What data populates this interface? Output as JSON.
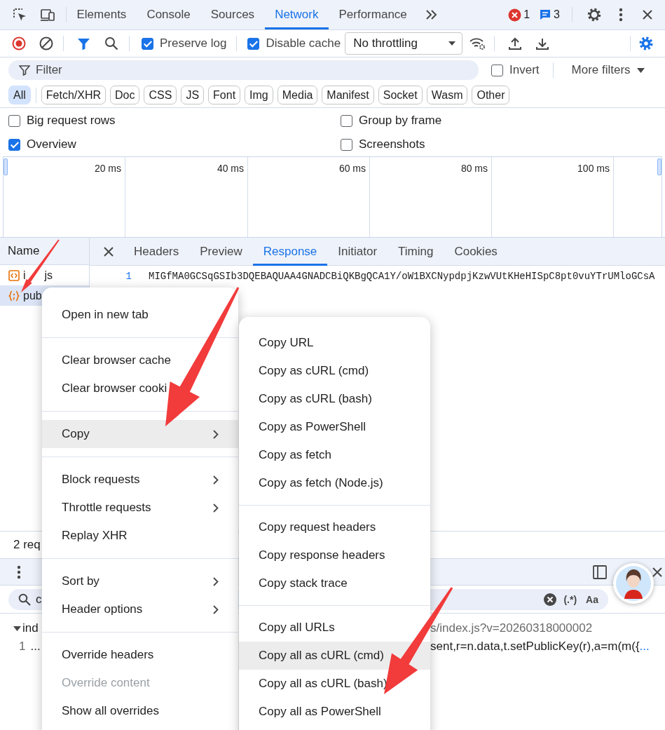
{
  "tabs": [
    {
      "label": "Elements",
      "selected": false
    },
    {
      "label": "Console",
      "selected": false
    },
    {
      "label": "Sources",
      "selected": false
    },
    {
      "label": "Network",
      "selected": true
    },
    {
      "label": "Performance",
      "selected": false
    }
  ],
  "error_count": "1",
  "message_count": "3",
  "toolbar": {
    "recording": true,
    "preserve_log": {
      "label": "Preserve log",
      "checked": true
    },
    "disable_cache": {
      "label": "Disable cache",
      "checked": true
    },
    "throttling": "No throttling"
  },
  "filter": {
    "placeholder": "Filter",
    "invert": {
      "label": "Invert",
      "checked": false
    },
    "more_filters": "More filters"
  },
  "type_filters": [
    {
      "label": "All",
      "selected": true
    },
    {
      "label": "Fetch/XHR",
      "selected": false
    },
    {
      "label": "Doc",
      "selected": false
    },
    {
      "label": "CSS",
      "selected": false
    },
    {
      "label": "JS",
      "selected": false
    },
    {
      "label": "Font",
      "selected": false
    },
    {
      "label": "Img",
      "selected": false
    },
    {
      "label": "Media",
      "selected": false
    },
    {
      "label": "Manifest",
      "selected": false
    },
    {
      "label": "Socket",
      "selected": false
    },
    {
      "label": "Wasm",
      "selected": false
    },
    {
      "label": "Other",
      "selected": false
    }
  ],
  "options": [
    {
      "label": "Big request rows",
      "checked": false
    },
    {
      "label": "Group by frame",
      "checked": false
    },
    {
      "label": "Overview",
      "checked": true
    },
    {
      "label": "Screenshots",
      "checked": false
    }
  ],
  "overview": {
    "ticks": [
      "20 ms",
      "40 ms",
      "60 ms",
      "80 ms",
      "100 ms"
    ]
  },
  "requests": {
    "column": "Name",
    "rows": [
      {
        "name_parts": [
          "i",
          "js"
        ],
        "kind": "script",
        "selected": false
      },
      {
        "name_parts": [
          "pub"
        ],
        "kind": "json",
        "selected": true
      }
    ]
  },
  "detail_tabs": [
    {
      "label": "Headers",
      "selected": false
    },
    {
      "label": "Preview",
      "selected": false
    },
    {
      "label": "Response",
      "selected": true
    },
    {
      "label": "Initiator",
      "selected": false
    },
    {
      "label": "Timing",
      "selected": false
    },
    {
      "label": "Cookies",
      "selected": false
    }
  ],
  "response": {
    "line_number": "1",
    "text": "MIGfMA0GCSqGSIb3DQEBAQUAA4GNADCBiQKBgQCA1Y/oW1BXCNypdpjKzwVUtKHeHISpC8pt0vuYTrUMloGCsA"
  },
  "status": "2 req",
  "search": {
    "value": "c",
    "regex": "(.*)",
    "match_case": "Aa"
  },
  "results": [
    {
      "expanded": true,
      "file_start": "ind",
      "file_end": "s/index.js?v=20260318000002",
      "line_number": "1",
      "snippet_start": "...",
      "snippet_end": "sent,r=n.data,t.setPublicKey(r),a=m(m({",
      "more": "..."
    }
  ],
  "context_menu": {
    "sections": [
      [
        {
          "label": "Open in new tab",
          "highlighted": false,
          "disabled": false,
          "submenu": false
        }
      ],
      [
        {
          "label": "Clear browser cache",
          "highlighted": false,
          "disabled": false,
          "submenu": false
        },
        {
          "label": "Clear browser cooki",
          "highlighted": false,
          "disabled": false,
          "submenu": false
        }
      ],
      [
        {
          "label": "Copy",
          "highlighted": true,
          "disabled": false,
          "submenu": true
        }
      ],
      [
        {
          "label": "Block requests",
          "highlighted": false,
          "disabled": false,
          "submenu": true
        },
        {
          "label": "Throttle requests",
          "highlighted": false,
          "disabled": false,
          "submenu": true
        },
        {
          "label": "Replay XHR",
          "highlighted": false,
          "disabled": false,
          "submenu": false
        }
      ],
      [
        {
          "label": "Sort by",
          "highlighted": false,
          "disabled": false,
          "submenu": true
        },
        {
          "label": "Header options",
          "highlighted": false,
          "disabled": false,
          "submenu": true
        }
      ],
      [
        {
          "label": "Override headers",
          "highlighted": false,
          "disabled": false,
          "submenu": false
        },
        {
          "label": "Override content",
          "highlighted": false,
          "disabled": true,
          "submenu": false
        },
        {
          "label": "Show all overrides",
          "highlighted": false,
          "disabled": false,
          "submenu": false
        }
      ]
    ]
  },
  "copy_submenu": {
    "sections": [
      [
        {
          "label": "Copy URL",
          "highlighted": false,
          "disabled": false,
          "submenu": false
        },
        {
          "label": "Copy as cURL (cmd)",
          "highlighted": false,
          "disabled": false,
          "submenu": false
        },
        {
          "label": "Copy as cURL (bash)",
          "highlighted": false,
          "disabled": false,
          "submenu": false
        },
        {
          "label": "Copy as PowerShell",
          "highlighted": false,
          "disabled": false,
          "submenu": false
        },
        {
          "label": "Copy as fetch",
          "highlighted": false,
          "disabled": false,
          "submenu": false
        },
        {
          "label": "Copy as fetch (Node.js)",
          "highlighted": false,
          "disabled": false,
          "submenu": false
        }
      ],
      [
        {
          "label": "Copy request headers",
          "highlighted": false,
          "disabled": false,
          "submenu": false
        },
        {
          "label": "Copy response headers",
          "highlighted": false,
          "disabled": false,
          "submenu": false
        },
        {
          "label": "Copy stack trace",
          "highlighted": false,
          "disabled": false,
          "submenu": false
        }
      ],
      [
        {
          "label": "Copy all URLs",
          "highlighted": false,
          "disabled": false,
          "submenu": false
        },
        {
          "label": "Copy all as cURL (cmd)",
          "highlighted": true,
          "disabled": false,
          "submenu": false
        },
        {
          "label": "Copy all as cURL (bash)",
          "highlighted": false,
          "disabled": false,
          "submenu": false
        },
        {
          "label": "Copy all as PowerShell",
          "highlighted": false,
          "disabled": false,
          "submenu": false
        }
      ]
    ]
  }
}
